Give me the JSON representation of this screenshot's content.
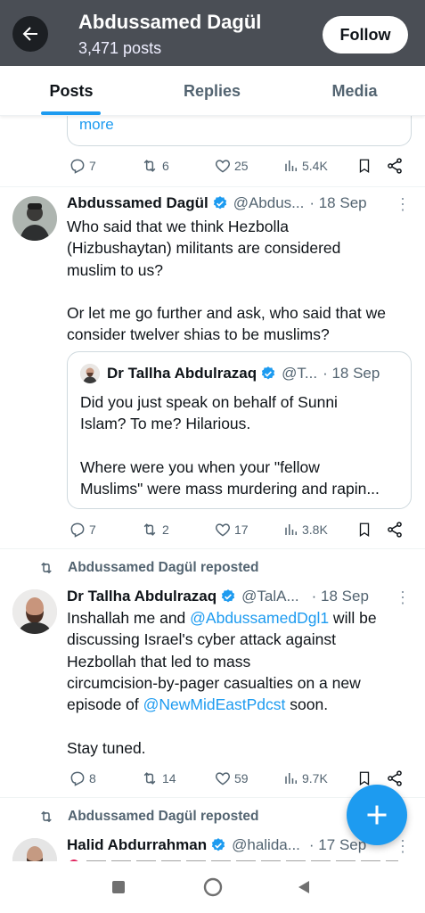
{
  "header": {
    "title": "Abdussamed Dagül",
    "post_count": "3,471 posts",
    "follow_label": "Follow"
  },
  "tabs": [
    {
      "label": "Posts",
      "active": true
    },
    {
      "label": "Replies",
      "active": false
    },
    {
      "label": "Media",
      "active": false
    }
  ],
  "previous_tweet": {
    "more_link": "more",
    "stats": {
      "replies": "7",
      "reposts": "6",
      "likes": "25",
      "views": "5.4K"
    }
  },
  "tweet1": {
    "name": "Abdussamed Dagül",
    "handle": "@Abdus...",
    "time": "· 18 Sep",
    "text_lines": [
      "Who said that we think Hezbolla",
      "(Hizbushaytan) militants are considered",
      "muslim to us?",
      "",
      "Or let me go further and ask, who said that we",
      "consider twelver shias to be muslims?"
    ],
    "quote": {
      "name": "Dr Tallha Abdulrazaq",
      "handle": "@T...",
      "time": "· 18 Sep",
      "text_lines": [
        "Did you just speak on behalf of Sunni",
        "Islam? To me? Hilarious.",
        "",
        "Where were you when your \"fellow",
        "Muslims\" were mass murdering and rapin..."
      ]
    },
    "stats": {
      "replies": "7",
      "reposts": "2",
      "likes": "17",
      "views": "3.8K"
    }
  },
  "tweet2": {
    "repost_label": "Abdussamed Dagül reposted",
    "name": "Dr Tallha Abdulrazaq",
    "handle": "@TalA...",
    "time": "· 18 Sep",
    "text": {
      "l1a": "Inshallah me and ",
      "l1_mention": "@AbdussamedDgl1",
      "l1b": " will be",
      "l2": "discussing Israel's cyber attack against",
      "l3": "Hezbollah that led to mass",
      "l4": "circumcision-by-pager casualties on a new",
      "l5a": "episode of ",
      "l5_mention": "@NewMidEastPdcst",
      "l5b": " soon.",
      "l7": "Stay tuned."
    },
    "stats": {
      "replies": "8",
      "reposts": "14",
      "likes": "59",
      "views": "9.7K"
    }
  },
  "tweet3": {
    "repost_label": "Abdussamed Dagül reposted",
    "name": "Halid Abdurrahman",
    "handle": "@halida...",
    "time": "· 17 Sep"
  },
  "colors": {
    "accent": "#1d9bf0",
    "header_bg": "#4a4e55",
    "muted": "#536471"
  }
}
